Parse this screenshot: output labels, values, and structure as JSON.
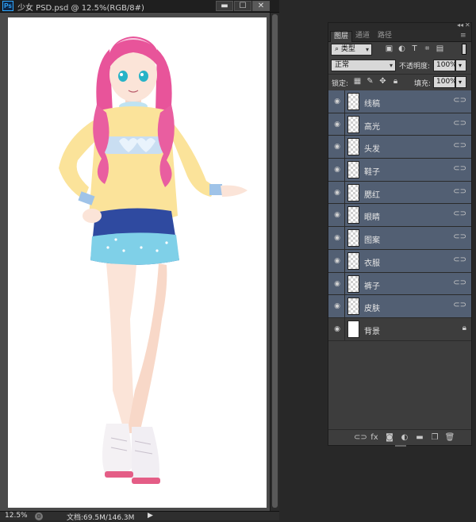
{
  "document": {
    "app_badge": "Ps",
    "title": "少女 PSD.psd @ 12.5%(RGB/8#)",
    "window_buttons": {
      "minimize": "▬",
      "maximize": "☐",
      "close": "✕"
    },
    "status": {
      "zoom": "12.5%",
      "doc_info": "文档:69.5M/146.3M",
      "arrow": "▶"
    }
  },
  "layers_panel": {
    "tabs": [
      "图层",
      "通道",
      "路径"
    ],
    "menu_icon": "≡",
    "filter": {
      "value": "类型",
      "icons": [
        "image-filter-icon",
        "adjustment-filter-icon",
        "type-filter-icon",
        "shape-filter-icon",
        "smart-object-filter-icon"
      ]
    },
    "blend_mode": "正常",
    "opacity_label": "不透明度:",
    "opacity": "100%",
    "lock_label": "锁定:",
    "fill_label": "填充:",
    "fill": "100%",
    "layers": [
      {
        "name": "线稿",
        "selected": true,
        "linked": true
      },
      {
        "name": "高光",
        "selected": true,
        "linked": true
      },
      {
        "name": "头发",
        "selected": true,
        "linked": true
      },
      {
        "name": "鞋子",
        "selected": true,
        "linked": true
      },
      {
        "name": "腮红",
        "selected": true,
        "linked": true
      },
      {
        "name": "眼睛",
        "selected": true,
        "linked": true
      },
      {
        "name": "图案",
        "selected": true,
        "linked": true
      },
      {
        "name": "衣服",
        "selected": true,
        "linked": true
      },
      {
        "name": "裤子",
        "selected": true,
        "linked": true
      },
      {
        "name": "皮肤",
        "selected": true,
        "linked": true
      },
      {
        "name": "背景",
        "selected": false,
        "linked": false,
        "locked": true
      }
    ]
  },
  "colors": {
    "selected_layer": "#525f73",
    "panel_bg": "#3d3d3d",
    "hair": "#e8549a",
    "sweater": "#fbe39a",
    "skirt": "#2f4aa0"
  }
}
